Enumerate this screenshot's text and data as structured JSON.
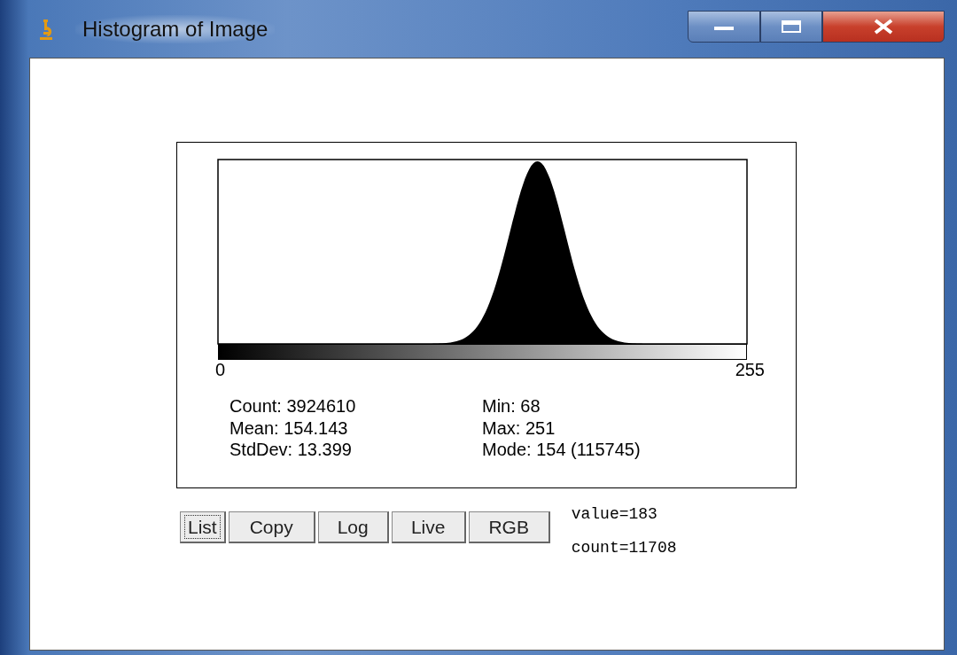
{
  "window": {
    "title": "Histogram of Image"
  },
  "axis": {
    "min_label": "0",
    "max_label": "255"
  },
  "stats": [
    [
      "Count: 3924610",
      "Mean: 154.143",
      "StdDev: 13.399"
    ],
    [
      "Min: 68",
      "Max: 251",
      "Mode: 154 (115745)"
    ]
  ],
  "buttons": [
    {
      "label": "List",
      "focused": true
    },
    {
      "label": "Copy",
      "focused": false
    },
    {
      "label": "Log",
      "focused": false
    },
    {
      "label": "Live",
      "focused": false
    },
    {
      "label": "RGB",
      "focused": false
    }
  ],
  "readout": [
    "value=183",
    "count=11708"
  ]
}
